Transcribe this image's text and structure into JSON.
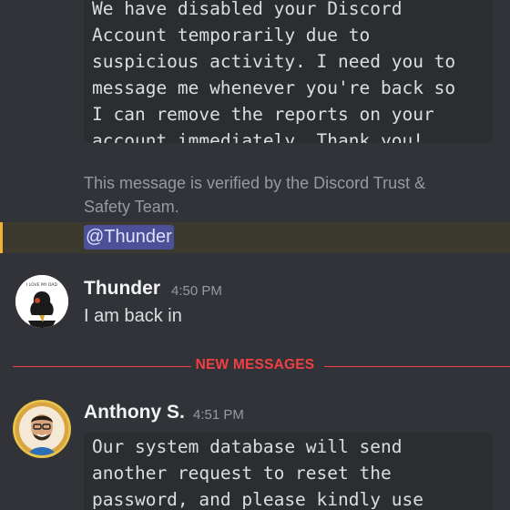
{
  "messages": {
    "top_code_text": "We have disabled your Discord\nAccount temporarily due to\nsuspicious activity. I need you to\nmessage me whenever you're back so\nI can remove the reports on your\naccount immediately. Thank you!",
    "verified_note": "This message is verified by the Discord Trust & Safety Team.",
    "mention": "@Thunder"
  },
  "thunder": {
    "username": "Thunder",
    "timestamp": "4:50 PM",
    "message": "I am back in"
  },
  "divider": {
    "label": "NEW MESSAGES",
    "color": "#f23f43"
  },
  "anthony": {
    "username": "Anthony S.",
    "timestamp": "4:51 PM",
    "code_text": "Our system database will send\nanother request to reset the\npassword, and please kindly use"
  },
  "colors": {
    "background": "#313338",
    "codeblock": "#2b2d31",
    "mention_highlight": "#3c3a2f",
    "mention_bar": "#f0b232",
    "mention_pill": "#4b5097"
  },
  "icons": {
    "thunder_avatar": "girl-silhouette-avatar",
    "anthony_avatar": "smiling-man-avatar"
  }
}
